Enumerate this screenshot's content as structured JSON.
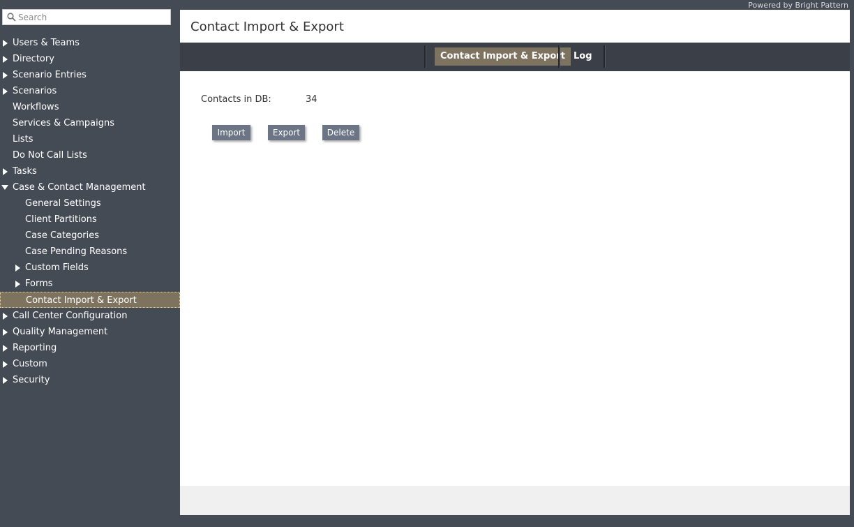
{
  "branding": {
    "powered_by": "Powered by Bright Pattern"
  },
  "search": {
    "placeholder": "Search",
    "icon": "search-icon"
  },
  "sidebar": {
    "items": [
      {
        "label": "Users & Teams",
        "level": 0,
        "arrow": "right"
      },
      {
        "label": "Directory",
        "level": 0,
        "arrow": "right"
      },
      {
        "label": "Scenario Entries",
        "level": 0,
        "arrow": "right"
      },
      {
        "label": "Scenarios",
        "level": 0,
        "arrow": "right"
      },
      {
        "label": "Workflows",
        "level": 0,
        "arrow": "none"
      },
      {
        "label": "Services & Campaigns",
        "level": 0,
        "arrow": "none"
      },
      {
        "label": "Lists",
        "level": 0,
        "arrow": "none"
      },
      {
        "label": "Do Not Call Lists",
        "level": 0,
        "arrow": "none"
      },
      {
        "label": "Tasks",
        "level": 0,
        "arrow": "right"
      },
      {
        "label": "Case & Contact Management",
        "level": 0,
        "arrow": "down"
      },
      {
        "label": "General Settings",
        "level": 1,
        "arrow": "none"
      },
      {
        "label": "Client Partitions",
        "level": 1,
        "arrow": "none"
      },
      {
        "label": "Case Categories",
        "level": 1,
        "arrow": "none"
      },
      {
        "label": "Case Pending Reasons",
        "level": 1,
        "arrow": "none"
      },
      {
        "label": "Custom Fields",
        "level": 1,
        "arrow": "right"
      },
      {
        "label": "Forms",
        "level": 1,
        "arrow": "right"
      },
      {
        "label": "Contact Import & Export",
        "level": 1,
        "arrow": "none",
        "selected": true
      },
      {
        "label": "Call Center Configuration",
        "level": 0,
        "arrow": "right"
      },
      {
        "label": "Quality Management",
        "level": 0,
        "arrow": "right"
      },
      {
        "label": "Reporting",
        "level": 0,
        "arrow": "right"
      },
      {
        "label": "Custom",
        "level": 0,
        "arrow": "right"
      },
      {
        "label": "Security",
        "level": 0,
        "arrow": "right"
      }
    ]
  },
  "main": {
    "title": "Contact Import & Export",
    "tabs": [
      {
        "label": "Contact Import & Export",
        "active": true
      },
      {
        "label": "Log",
        "active": false
      }
    ],
    "contacts_label": "Contacts in DB:",
    "contacts_value": "34",
    "buttons": {
      "import": "Import",
      "export": "Export",
      "delete": "Delete"
    }
  },
  "colors": {
    "sidebar_bg": "#454b55",
    "selected_bg": "#7d735f",
    "tabbar_bg": "#3b4048",
    "button_bg": "#6c7585"
  }
}
